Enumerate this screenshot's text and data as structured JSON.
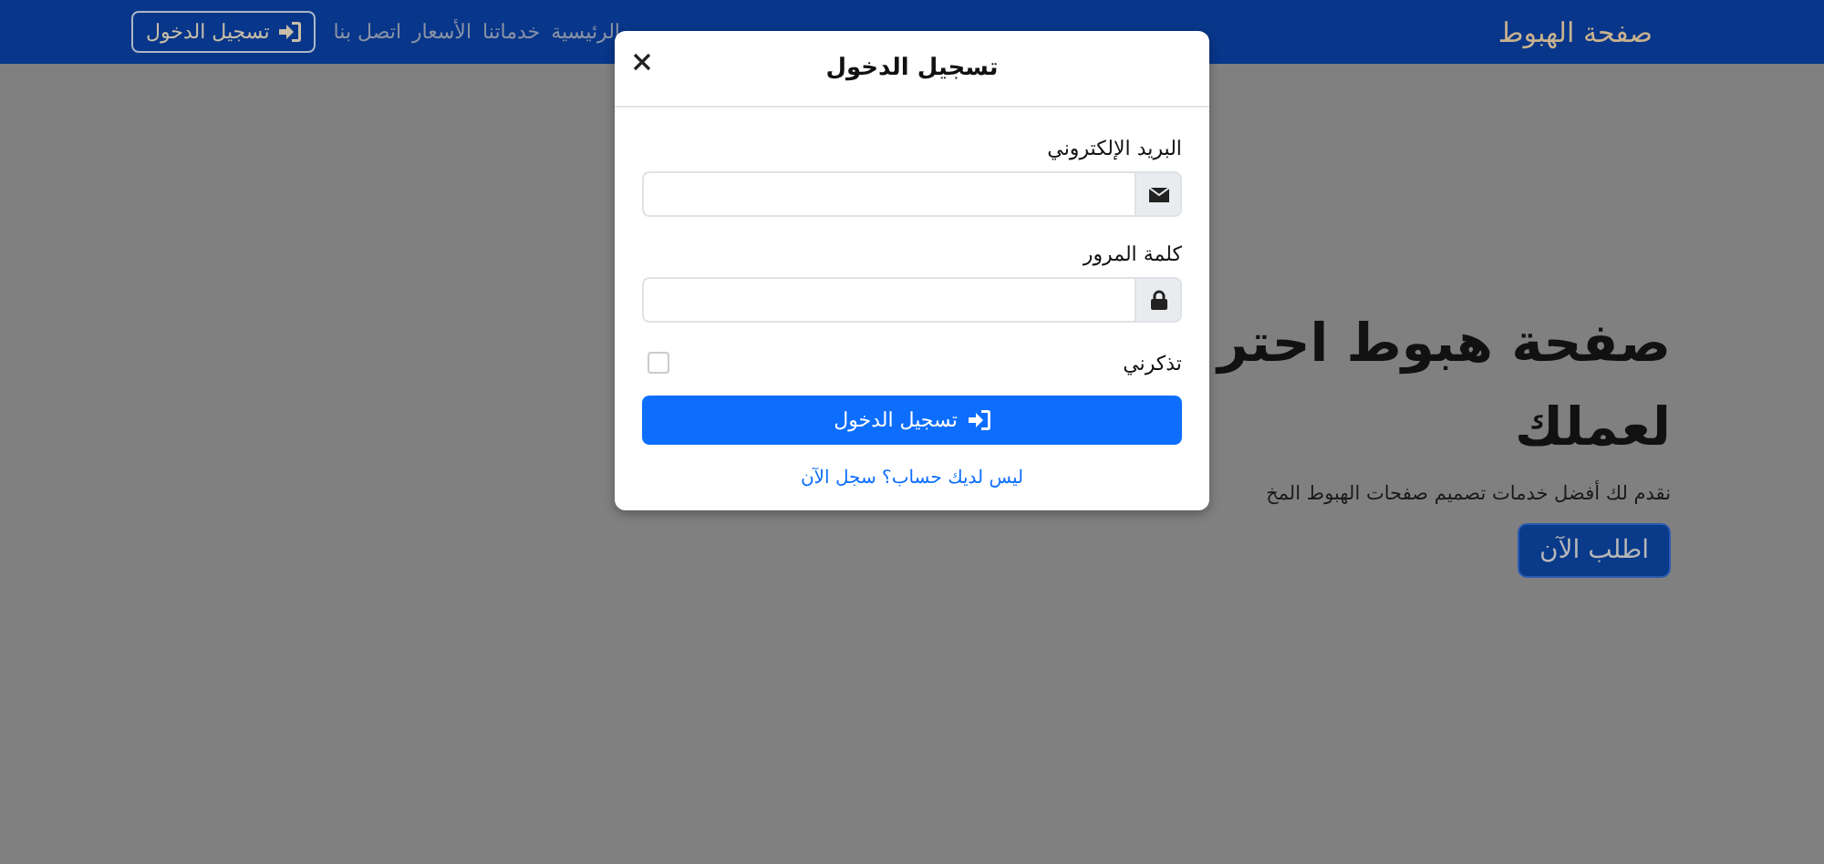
{
  "navbar": {
    "brand": "صفحة الهبوط",
    "links": [
      "الرئيسية",
      "خدماتنا",
      "الأسعار",
      "اتصل بنا"
    ],
    "login_button": "تسجيل الدخول"
  },
  "hero": {
    "heading_lines": [
      "صفحة هبوط احتر",
      "لعملك"
    ],
    "subtitle": "نقدم لك أفضل خدمات تصميم صفحات الهبوط المخ",
    "cta": "اطلب الآن"
  },
  "modal": {
    "title": "تسجيل الدخول",
    "email_label": "البريد الإلكتروني",
    "password_label": "كلمة المرور",
    "remember": {
      "label": "تذكرني",
      "checked": false
    },
    "submit": "تسجيل الدخول",
    "register_link": "ليس لديك حساب؟ سجل الآن"
  }
}
